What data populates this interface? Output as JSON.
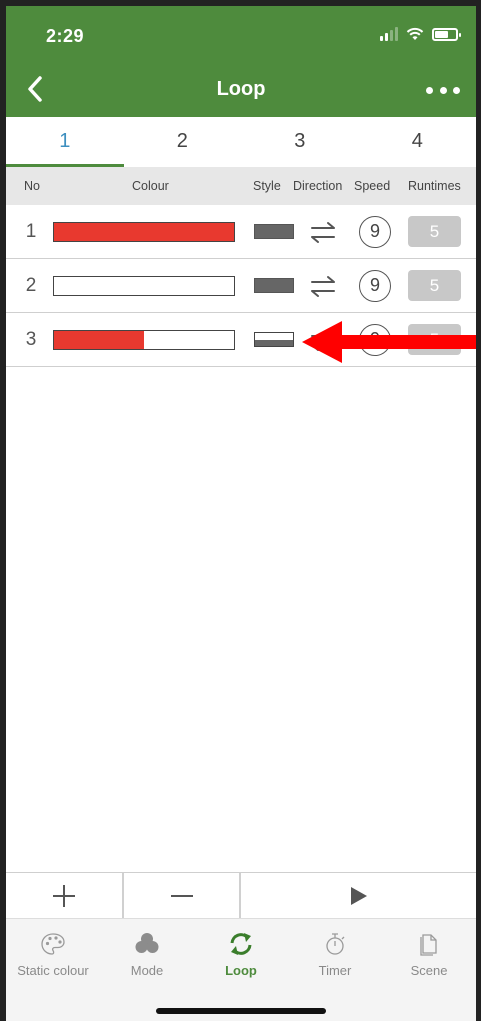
{
  "status_bar": {
    "time": "2:29"
  },
  "header": {
    "title": "Loop"
  },
  "tabs": [
    {
      "label": "1",
      "active": true
    },
    {
      "label": "2",
      "active": false
    },
    {
      "label": "3",
      "active": false
    },
    {
      "label": "4",
      "active": false
    }
  ],
  "columns": {
    "no": "No",
    "colour": "Colour",
    "style": "Style",
    "direction": "Direction",
    "speed": "Speed",
    "runtimes": "Runtimes"
  },
  "rows": [
    {
      "no": "1",
      "colour_fill": 1.0,
      "style": "solid",
      "speed": "9",
      "runtimes": "5"
    },
    {
      "no": "2",
      "colour_fill": 0.0,
      "style": "solid",
      "speed": "9",
      "runtimes": "5"
    },
    {
      "no": "3",
      "colour_fill": 0.5,
      "style": "split",
      "speed": "9",
      "runtimes": "5"
    }
  ],
  "colors": {
    "header_green": "#4e8b3d",
    "active_tab": "#3d8fbf",
    "fill_red": "#e8392f",
    "annotation_red": "#ff0000"
  },
  "tabbar": [
    {
      "label": "Static colour",
      "icon": "palette-icon",
      "active": false
    },
    {
      "label": "Mode",
      "icon": "clover-icon",
      "active": false
    },
    {
      "label": "Loop",
      "icon": "loop-icon",
      "active": true
    },
    {
      "label": "Timer",
      "icon": "stopwatch-icon",
      "active": false
    },
    {
      "label": "Scene",
      "icon": "document-icon",
      "active": false
    }
  ]
}
